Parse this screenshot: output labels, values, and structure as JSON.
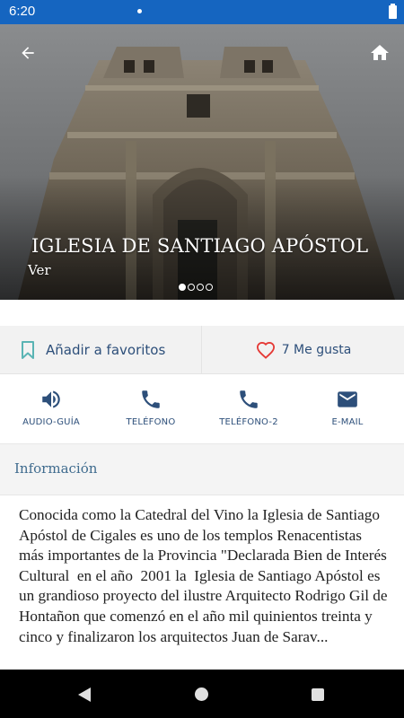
{
  "status_bar": {
    "time": "6:20",
    "bg_color": "#1565c0"
  },
  "hero": {
    "title": "IGLESIA DE SANTIAGO APÓSTOL",
    "subtitle": "Ver",
    "slides_total": 4,
    "active_slide": 1,
    "back_icon": "arrow-back-icon",
    "home_icon": "home-icon"
  },
  "actions": {
    "favorite": {
      "label": "Añadir a favoritos",
      "icon": "bookmark-icon"
    },
    "like": {
      "label": "7 Me gusta",
      "icon": "heart-icon",
      "color": "#e53935"
    }
  },
  "contact": {
    "items": [
      {
        "label": "AUDIO-GUÍA",
        "icon": "speaker-icon"
      },
      {
        "label": "TELÉFONO",
        "icon": "phone-icon"
      },
      {
        "label": "TELÉFONO-2",
        "icon": "phone-icon"
      },
      {
        "label": "E-MAIL",
        "icon": "mail-icon"
      }
    ],
    "icon_color": "#2d4f7a"
  },
  "info": {
    "title": "Información",
    "body": "Conocida como la Catedral del Vino la Iglesia de Santiago Apóstol de Cigales es uno de los templos Renacentistas más importantes de la Provincia \"Declarada Bien de Interés Cultural  en el año  2001 la  Iglesia de Santiago Apóstol es un grandioso proyecto del ilustre Arquitecto Rodrigo Gil de Hontañon que comenzó en el año mil quinientos treinta y cinco y finalizaron los arquitectos Juan de Sarav..."
  },
  "nav_bar": {
    "back_icon": "nav-back-icon",
    "home_icon": "nav-home-icon",
    "recent_icon": "nav-recent-icon"
  }
}
